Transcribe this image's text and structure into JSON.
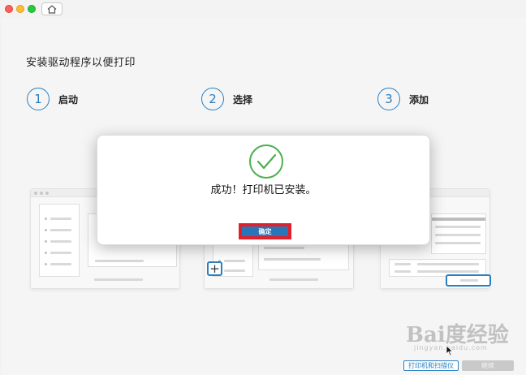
{
  "window": {
    "home_icon": "home-icon"
  },
  "page": {
    "heading": "安装驱动程序以便打印",
    "steps": [
      {
        "number": "1",
        "label": "启动"
      },
      {
        "number": "2",
        "label": "选择"
      },
      {
        "number": "3",
        "label": "添加"
      }
    ]
  },
  "dialog": {
    "icon": "checkmark-icon",
    "message": "成功！打印机已安装。",
    "confirm_label": "确定"
  },
  "footer": {
    "printers_label": "打印机和扫描仪",
    "continue_label": "继续"
  },
  "watermark": {
    "text": "Bai度经验",
    "sub": "jingyan.baidu.com"
  },
  "colors": {
    "accent": "#2a7fc0",
    "success": "#4caf50",
    "highlight": "#e0212b"
  }
}
